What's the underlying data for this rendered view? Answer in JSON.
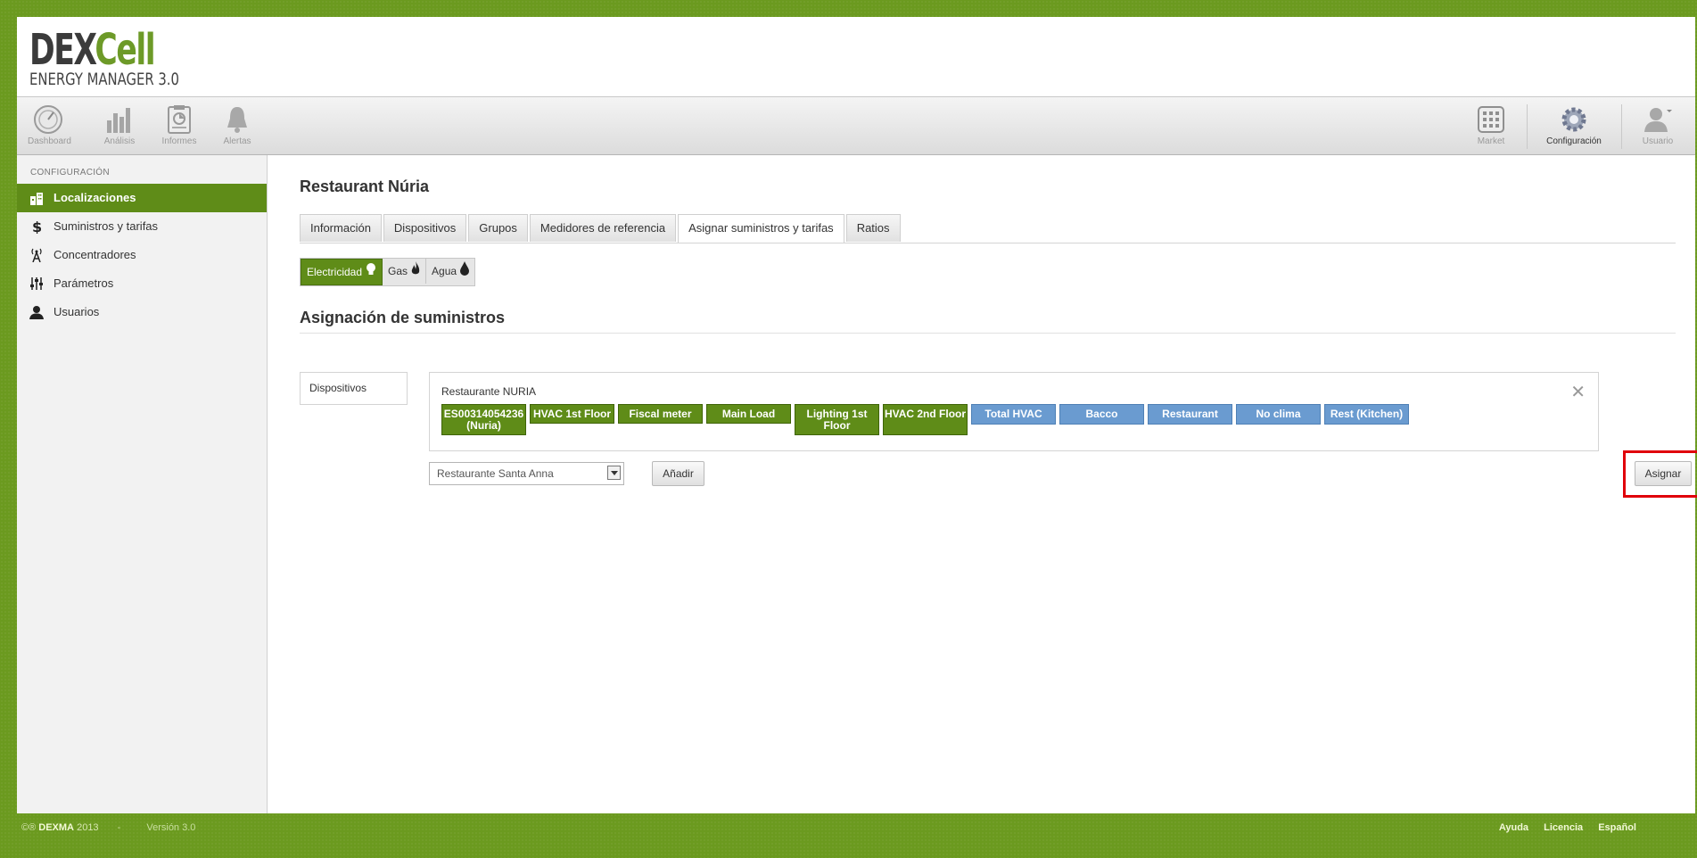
{
  "logo": {
    "brand_dark": "DEX",
    "brand_green": "Cell",
    "subtitle": "ENERGY MANAGER 3.0"
  },
  "toolbar": {
    "left": [
      {
        "label": "Dashboard",
        "icon": "gauge-icon"
      },
      {
        "label": "Análisis",
        "icon": "bar-chart-icon"
      },
      {
        "label": "Informes",
        "icon": "report-icon"
      },
      {
        "label": "Alertas",
        "icon": "bell-icon"
      }
    ],
    "right": [
      {
        "label": "Market",
        "icon": "grid-icon"
      },
      {
        "label": "Configuración",
        "icon": "gear-icon"
      },
      {
        "label": "Usuario",
        "icon": "user-icon"
      }
    ]
  },
  "sidebar": {
    "title": "CONFIGURACIÓN",
    "items": [
      {
        "label": "Localizaciones",
        "icon": "buildings-icon"
      },
      {
        "label": "Suministros y tarifas",
        "icon": "dollar-icon"
      },
      {
        "label": "Concentradores",
        "icon": "antenna-icon"
      },
      {
        "label": "Parámetros",
        "icon": "sliders-icon"
      },
      {
        "label": "Usuarios",
        "icon": "user-icon"
      }
    ]
  },
  "main": {
    "title": "Restaurant Núria",
    "tabs": [
      "Información",
      "Dispositivos",
      "Grupos",
      "Medidores de referencia",
      "Asignar suministros y tarifas",
      "Ratios"
    ],
    "active_tab": "Asignar suministros y tarifas",
    "energy": [
      {
        "label": "Electricidad",
        "icon": "bulb-icon"
      },
      {
        "label": "Gas",
        "icon": "flame-icon"
      },
      {
        "label": "Agua",
        "icon": "drop-icon"
      }
    ],
    "section_title": "Asignación de suministros",
    "devices_label": "Dispositivos",
    "location_name": "Restaurante NURIA",
    "chips": [
      {
        "label": "ES00314054236 (Nuria)",
        "color": "green"
      },
      {
        "label": "HVAC 1st Floor",
        "color": "green"
      },
      {
        "label": "Fiscal meter",
        "color": "green"
      },
      {
        "label": "Main Load",
        "color": "green"
      },
      {
        "label": "Lighting 1st Floor",
        "color": "green"
      },
      {
        "label": "HVAC 2nd Floor",
        "color": "green"
      },
      {
        "label": "Total HVAC",
        "color": "blue"
      },
      {
        "label": "Bacco",
        "color": "blue"
      },
      {
        "label": "Restaurant",
        "color": "blue"
      },
      {
        "label": "No clima",
        "color": "blue"
      },
      {
        "label": "Rest (Kitchen)",
        "color": "blue"
      }
    ],
    "select_value": "Restaurante Santa Anna",
    "add_button": "Añadir",
    "assign_button": "Asignar",
    "close_symbol": "✕"
  },
  "footer": {
    "copyright_prefix": "©®",
    "company": "DEXMA",
    "year": "2013",
    "separator": "-",
    "version": "Versión 3.0",
    "links": [
      "Ayuda",
      "Licencia",
      "Español"
    ]
  },
  "colors": {
    "brand_green": "#5f8c18",
    "chip_blue": "#6a9bd0",
    "highlight_red": "#e0000a"
  }
}
